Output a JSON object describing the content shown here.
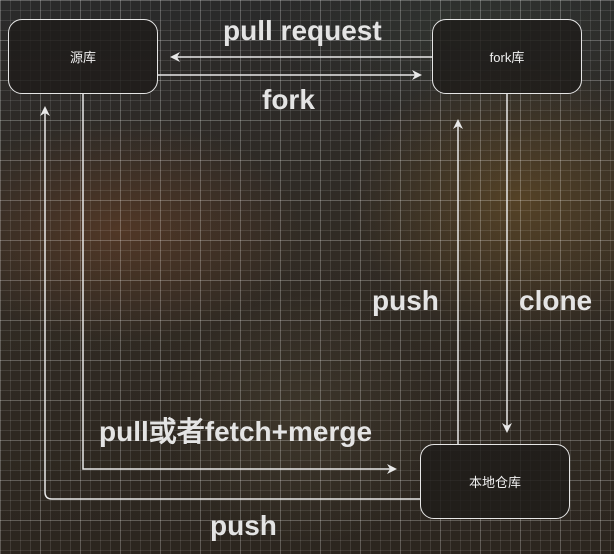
{
  "nodes": {
    "source": "源库",
    "fork": "fork库",
    "local": "本地仓库"
  },
  "edges": {
    "pull_request": "pull request",
    "fork": "fork",
    "push_to_fork": "push",
    "clone": "clone",
    "pull_fetch_merge": "pull或者fetch+merge",
    "push_to_source": "push"
  },
  "colors": {
    "line": "#e8e8e8",
    "node_border": "#e6e6e6",
    "label_text": "#e4e4e4"
  }
}
